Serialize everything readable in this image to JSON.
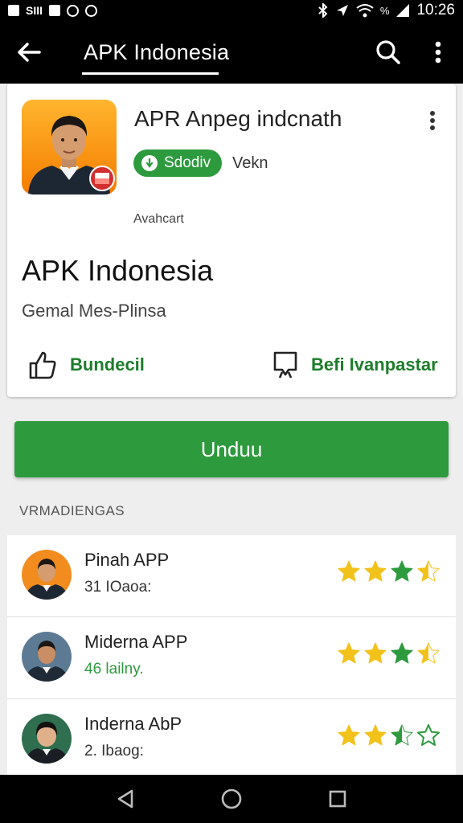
{
  "status_bar": {
    "left_text": "SIII",
    "right_text": "%",
    "time": "10:26"
  },
  "app_bar": {
    "title": "APK Indonesia",
    "icons": [
      "back-arrow-icon",
      "search-icon",
      "more-vert-icon"
    ]
  },
  "app_card": {
    "name": "APR Anpeg indcnath",
    "badge_label": "Sdodiv",
    "badge_side_text": "Vekn",
    "small_label": "Avahcart",
    "heading": "APK Indonesia",
    "subtitle": "Gemal Mes-Plinsa",
    "like_label": "Bundecil",
    "save_label": "Befi Ivanpastar",
    "colors": {
      "accent": "#2e9a3e",
      "icon_bg": "#f57c00"
    }
  },
  "install_button": {
    "label": "Unduu"
  },
  "section": {
    "header": "VRMADIENGAS"
  },
  "list": {
    "items": [
      {
        "title": "Pinah APP",
        "subtitle": "31 IOaoa:",
        "subtitle_color": "dark",
        "rating": 3.5,
        "avatar_bg": "#f28c1e"
      },
      {
        "title": "Miderna APP",
        "subtitle": "46 lailny.",
        "subtitle_color": "green",
        "rating": 3.5,
        "avatar_bg": "#5c7a93"
      },
      {
        "title": "Inderna AbP",
        "subtitle": "2. Ibaog:",
        "subtitle_color": "dark",
        "rating": 2.5,
        "avatar_bg": "#2f6e4f"
      }
    ]
  },
  "nav_bar": {
    "icons": [
      "back-triangle-icon",
      "home-circle-icon",
      "recents-square-icon"
    ]
  }
}
